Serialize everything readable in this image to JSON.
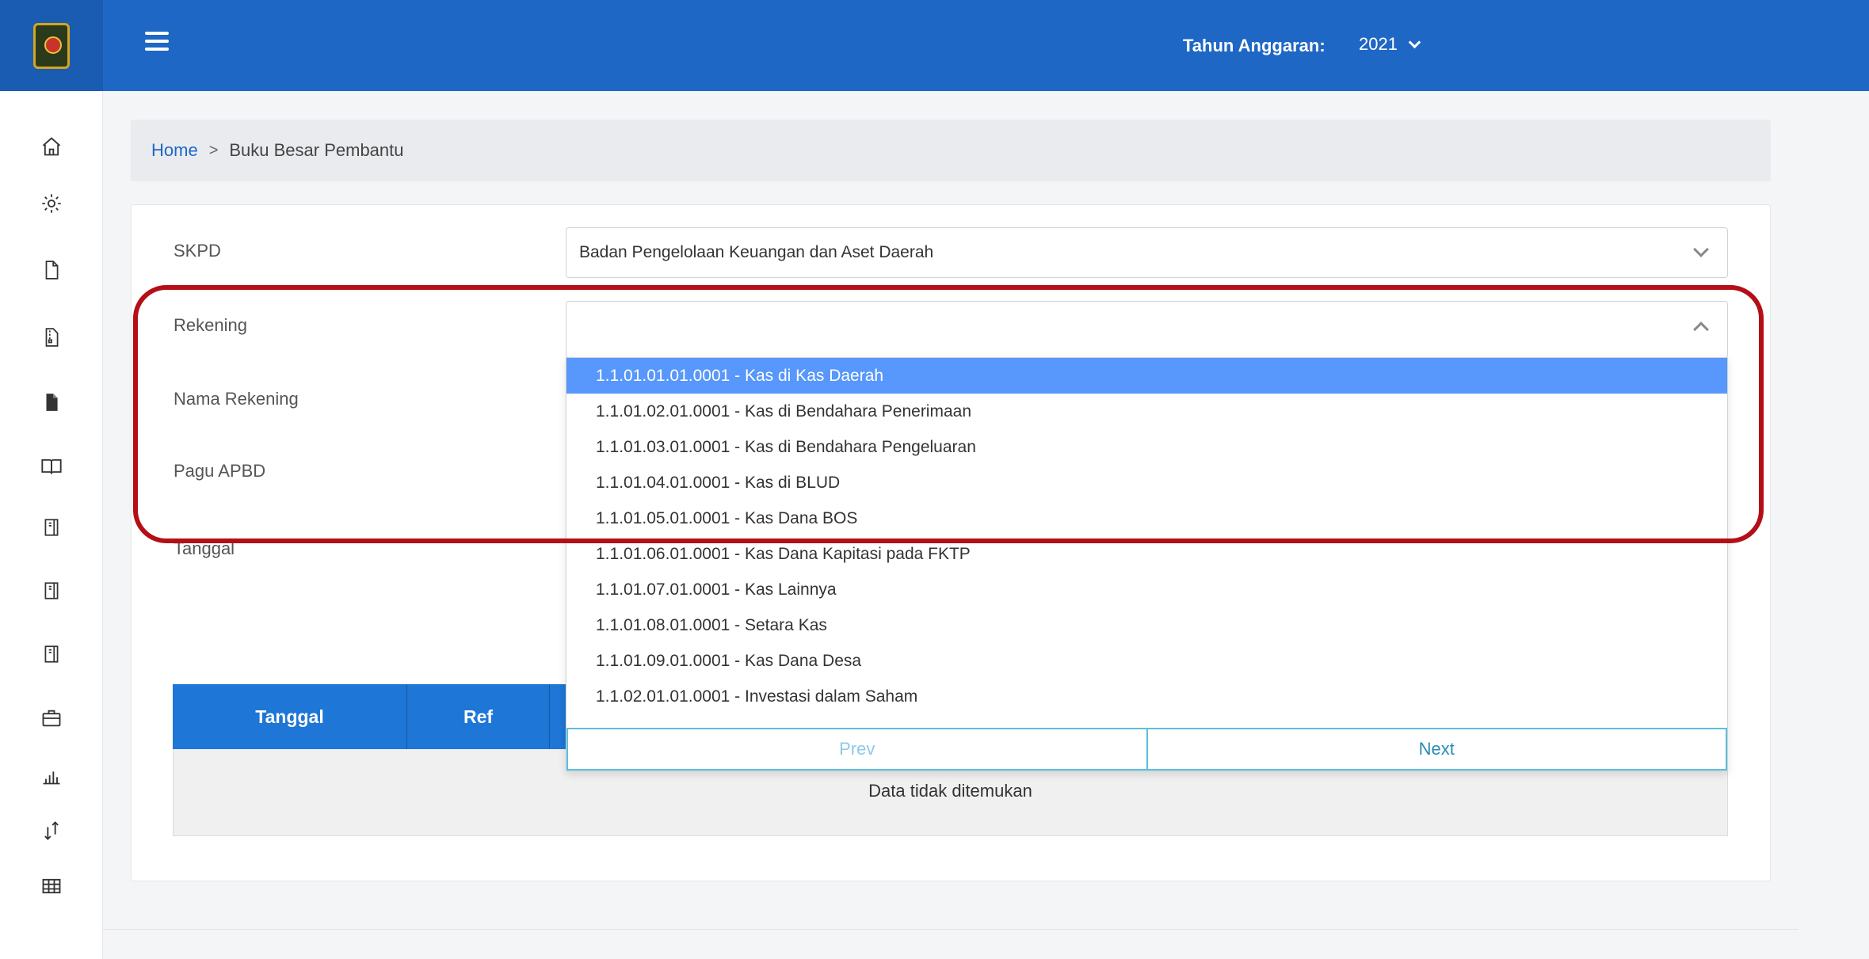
{
  "header": {
    "year_label": "Tahun Anggaran:",
    "year_value": "2021",
    "brand_color": "#1e67c5"
  },
  "sidebar": {
    "icons": [
      "home-icon",
      "gear-icon",
      "file-icon",
      "file-zip-icon",
      "file-filled-icon",
      "book-icon",
      "notebook-icon",
      "notebook-icon",
      "notebook-icon",
      "briefcase-icon",
      "bar-chart-icon",
      "sort-arrows-icon",
      "table-grid-icon"
    ]
  },
  "breadcrumb": {
    "home": "Home",
    "separator": ">",
    "current": "Buku Besar Pembantu"
  },
  "form": {
    "skpd_label": "SKPD",
    "skpd_value": "Badan Pengelolaan Keuangan dan Aset Daerah",
    "rekening_label": "Rekening",
    "rekening_value": "",
    "nama_rekening_label": "Nama Rekening",
    "pagu_label": "Pagu APBD",
    "tanggal_label": "Tanggal"
  },
  "dropdown": {
    "options": [
      "1.1.01.01.01.0001 - Kas di Kas Daerah",
      "1.1.01.02.01.0001 - Kas di Bendahara Penerimaan",
      "1.1.01.03.01.0001 - Kas di Bendahara Pengeluaran",
      "1.1.01.04.01.0001 - Kas di BLUD",
      "1.1.01.05.01.0001 - Kas Dana BOS",
      "1.1.01.06.01.0001 - Kas Dana Kapitasi pada FKTP",
      "1.1.01.07.01.0001 - Kas Lainnya",
      "1.1.01.08.01.0001 - Setara Kas",
      "1.1.01.09.01.0001 - Kas Dana Desa",
      "1.1.02.01.01.0001 - Investasi dalam Saham"
    ],
    "prev_label": "Prev",
    "next_label": "Next",
    "highlight_color": "#5897fb"
  },
  "table": {
    "columns": [
      "Tanggal",
      "Ref"
    ],
    "empty_message": "Data tidak ditemukan"
  }
}
